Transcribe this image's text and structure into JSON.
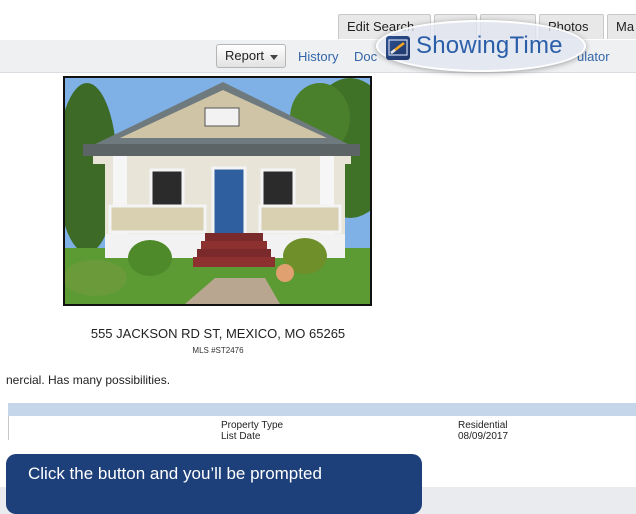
{
  "tabs": [
    "Edit Search",
    "",
    "",
    "Photos",
    "Ma"
  ],
  "toolbar": {
    "report_label": "Report",
    "history_label": "History",
    "docs_label": "Doc",
    "calculator_label": "ulator"
  },
  "badge": {
    "text": "ShowingTime",
    "logo_icon": "showingtime-logo-icon"
  },
  "listing": {
    "address": "555 JACKSON RD ST, MEXICO, MO 65265",
    "mls": "MLS #ST2476",
    "remarks": "nercial. Has many possibilities."
  },
  "details": {
    "property_type_label": "Property Type",
    "property_type_value": "Residential",
    "list_date_label": "List Date",
    "list_date_value": "08/09/2017"
  },
  "tooltip": {
    "text": "Click the button and you’ll be prompted"
  },
  "colors": {
    "link": "#3366aa",
    "brand": "#2a5ea9",
    "band": "#c5d5ea",
    "tooltip": "#1d3f7a"
  }
}
